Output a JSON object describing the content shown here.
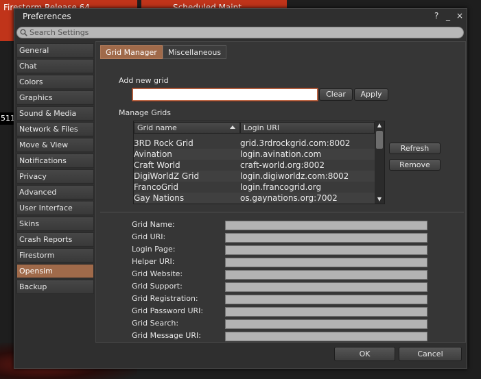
{
  "background": {
    "banner_left": "Firestorm Release 64",
    "banner_right": "Scheduled Maint",
    "side_number": "511"
  },
  "window": {
    "title": "Preferences",
    "help": "?",
    "minimize": "_",
    "close": "×"
  },
  "search": {
    "placeholder": "Search Settings"
  },
  "categories": [
    {
      "label": "General"
    },
    {
      "label": "Chat"
    },
    {
      "label": "Colors"
    },
    {
      "label": "Graphics"
    },
    {
      "label": "Sound & Media"
    },
    {
      "label": "Network & Files"
    },
    {
      "label": "Move & View"
    },
    {
      "label": "Notifications"
    },
    {
      "label": "Privacy"
    },
    {
      "label": "Advanced"
    },
    {
      "label": "User Interface"
    },
    {
      "label": "Skins"
    },
    {
      "label": "Crash Reports"
    },
    {
      "label": "Firestorm"
    },
    {
      "label": "Opensim",
      "selected": true
    },
    {
      "label": "Backup"
    }
  ],
  "tabs": [
    {
      "label": "Grid Manager",
      "active": true
    },
    {
      "label": "Miscellaneous",
      "active": false
    }
  ],
  "add_grid": {
    "label": "Add new grid",
    "value": "",
    "clear_label": "Clear",
    "apply_label": "Apply"
  },
  "manage": {
    "label": "Manage Grids",
    "columns": [
      "Grid name",
      "Login URI"
    ],
    "rows": [
      {
        "name": "3RD Rock Grid",
        "uri": "grid.3rdrockgrid.com:8002"
      },
      {
        "name": "Avination",
        "uri": "login.avination.com"
      },
      {
        "name": "Craft World",
        "uri": "craft-world.org:8002"
      },
      {
        "name": "DigiWorldZ Grid",
        "uri": "login.digiworldz.com:8002"
      },
      {
        "name": "FrancoGrid",
        "uri": "login.francogrid.org"
      },
      {
        "name": "Gay Nations",
        "uri": "os.gaynations.org:7002"
      }
    ],
    "refresh_label": "Refresh",
    "remove_label": "Remove"
  },
  "details": [
    {
      "label": "Grid Name:"
    },
    {
      "label": "Grid URI:"
    },
    {
      "label": "Login Page:"
    },
    {
      "label": "Helper URI:"
    },
    {
      "label": "Grid Website:"
    },
    {
      "label": "Grid Support:"
    },
    {
      "label": "Grid Registration:"
    },
    {
      "label": "Grid Password URI:"
    },
    {
      "label": "Grid Search:"
    },
    {
      "label": "Grid Message URI:"
    }
  ],
  "footer": {
    "ok_label": "OK",
    "cancel_label": "Cancel"
  },
  "colors": {
    "accent": "#a06a4a",
    "banner": "#c0341a",
    "panel": "#363636"
  }
}
